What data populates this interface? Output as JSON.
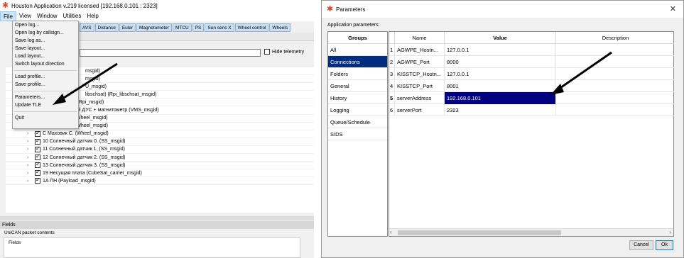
{
  "left_window": {
    "title": "Houston Application v.219 licensed  [192.168.0.101 : 2323]",
    "menu": [
      "File",
      "View",
      "Window",
      "Utilities",
      "Help"
    ],
    "tabs": [
      "AVS",
      "Distance",
      "Euler",
      "Magnetometer",
      "MTCU",
      "PS",
      "Sun sens X",
      "Wheel control",
      "Wheels"
    ],
    "hide_telemetry_label": "Hide telemetry",
    "file_menu": {
      "group1": [
        "Open log...",
        "Open log by callsign...",
        "Save log as...",
        "Save layout...",
        "Load layout...",
        "Switch layout direction"
      ],
      "group2": [
        "Load profile...",
        "Save profile..."
      ],
      "group3": [
        "Parameters...",
        "Update TLE"
      ],
      "group4": [
        "Quit"
      ]
    },
    "tree_partial": [
      "msgid)",
      "msgid)",
      "U_msgid)",
      "libschsat) (Rpi_libschsat_msgid)"
    ],
    "tree_items": [
      "F Raspberry Pi (Rpi_msgid)",
      "9 Совмещённый ДУС + магнитометр (VMS_msgid)",
      "A Маховик A. (Wheel_msgid)",
      "B Маховик B. (Wheel_msgid)",
      "C Маховик C. (Wheel_msgid)",
      "10 Солнечный датчик 0. (SS_msgid)",
      "11 Солнечный датчик 1. (SS_msgid)",
      "12 Солнечный датчик 2. (SS_msgid)",
      "13 Солнечный датчик 3. (SS_msgid)",
      "19 Несущая плата (CubeSat_carrier_msgid)",
      "1A ПН (Payload_msgid)"
    ],
    "fields_header": "Fields",
    "unican_label": "UniCAN packet contents",
    "fields_box_label": "Fields"
  },
  "dialog": {
    "title": "Parameters",
    "app_params_label": "Application parameters:",
    "groups_header": "Groups",
    "groups": [
      "All",
      "Connections",
      "Folders",
      "General",
      "History",
      "Logging",
      "Queue/Schedule",
      "SIDS"
    ],
    "selected_group": "Connections",
    "columns": [
      "Name",
      "Value",
      "Description"
    ],
    "rows": [
      {
        "num": "1",
        "name": "AGWPE_Hostn...",
        "value": "127.0.0.1",
        "desc": ""
      },
      {
        "num": "2",
        "name": "AGWPE_Port",
        "value": "8000",
        "desc": ""
      },
      {
        "num": "3",
        "name": "KISSTCP_Hostn...",
        "value": "127.0.0.1",
        "desc": ""
      },
      {
        "num": "4",
        "name": "KISSTCP_Port",
        "value": "8001",
        "desc": ""
      },
      {
        "num": "5",
        "name": "serverAddress",
        "value": "192.168.0.101",
        "desc": ""
      },
      {
        "num": "6",
        "name": "serverPort",
        "value": "2323",
        "desc": ""
      }
    ],
    "cancel_label": "Cancel",
    "ok_label": "Ok"
  },
  "colors": {
    "selection_dark": "#000080",
    "group_selected": "#002d7d",
    "tab_bg": "#c9def0",
    "app_icon": "#d9442f"
  }
}
